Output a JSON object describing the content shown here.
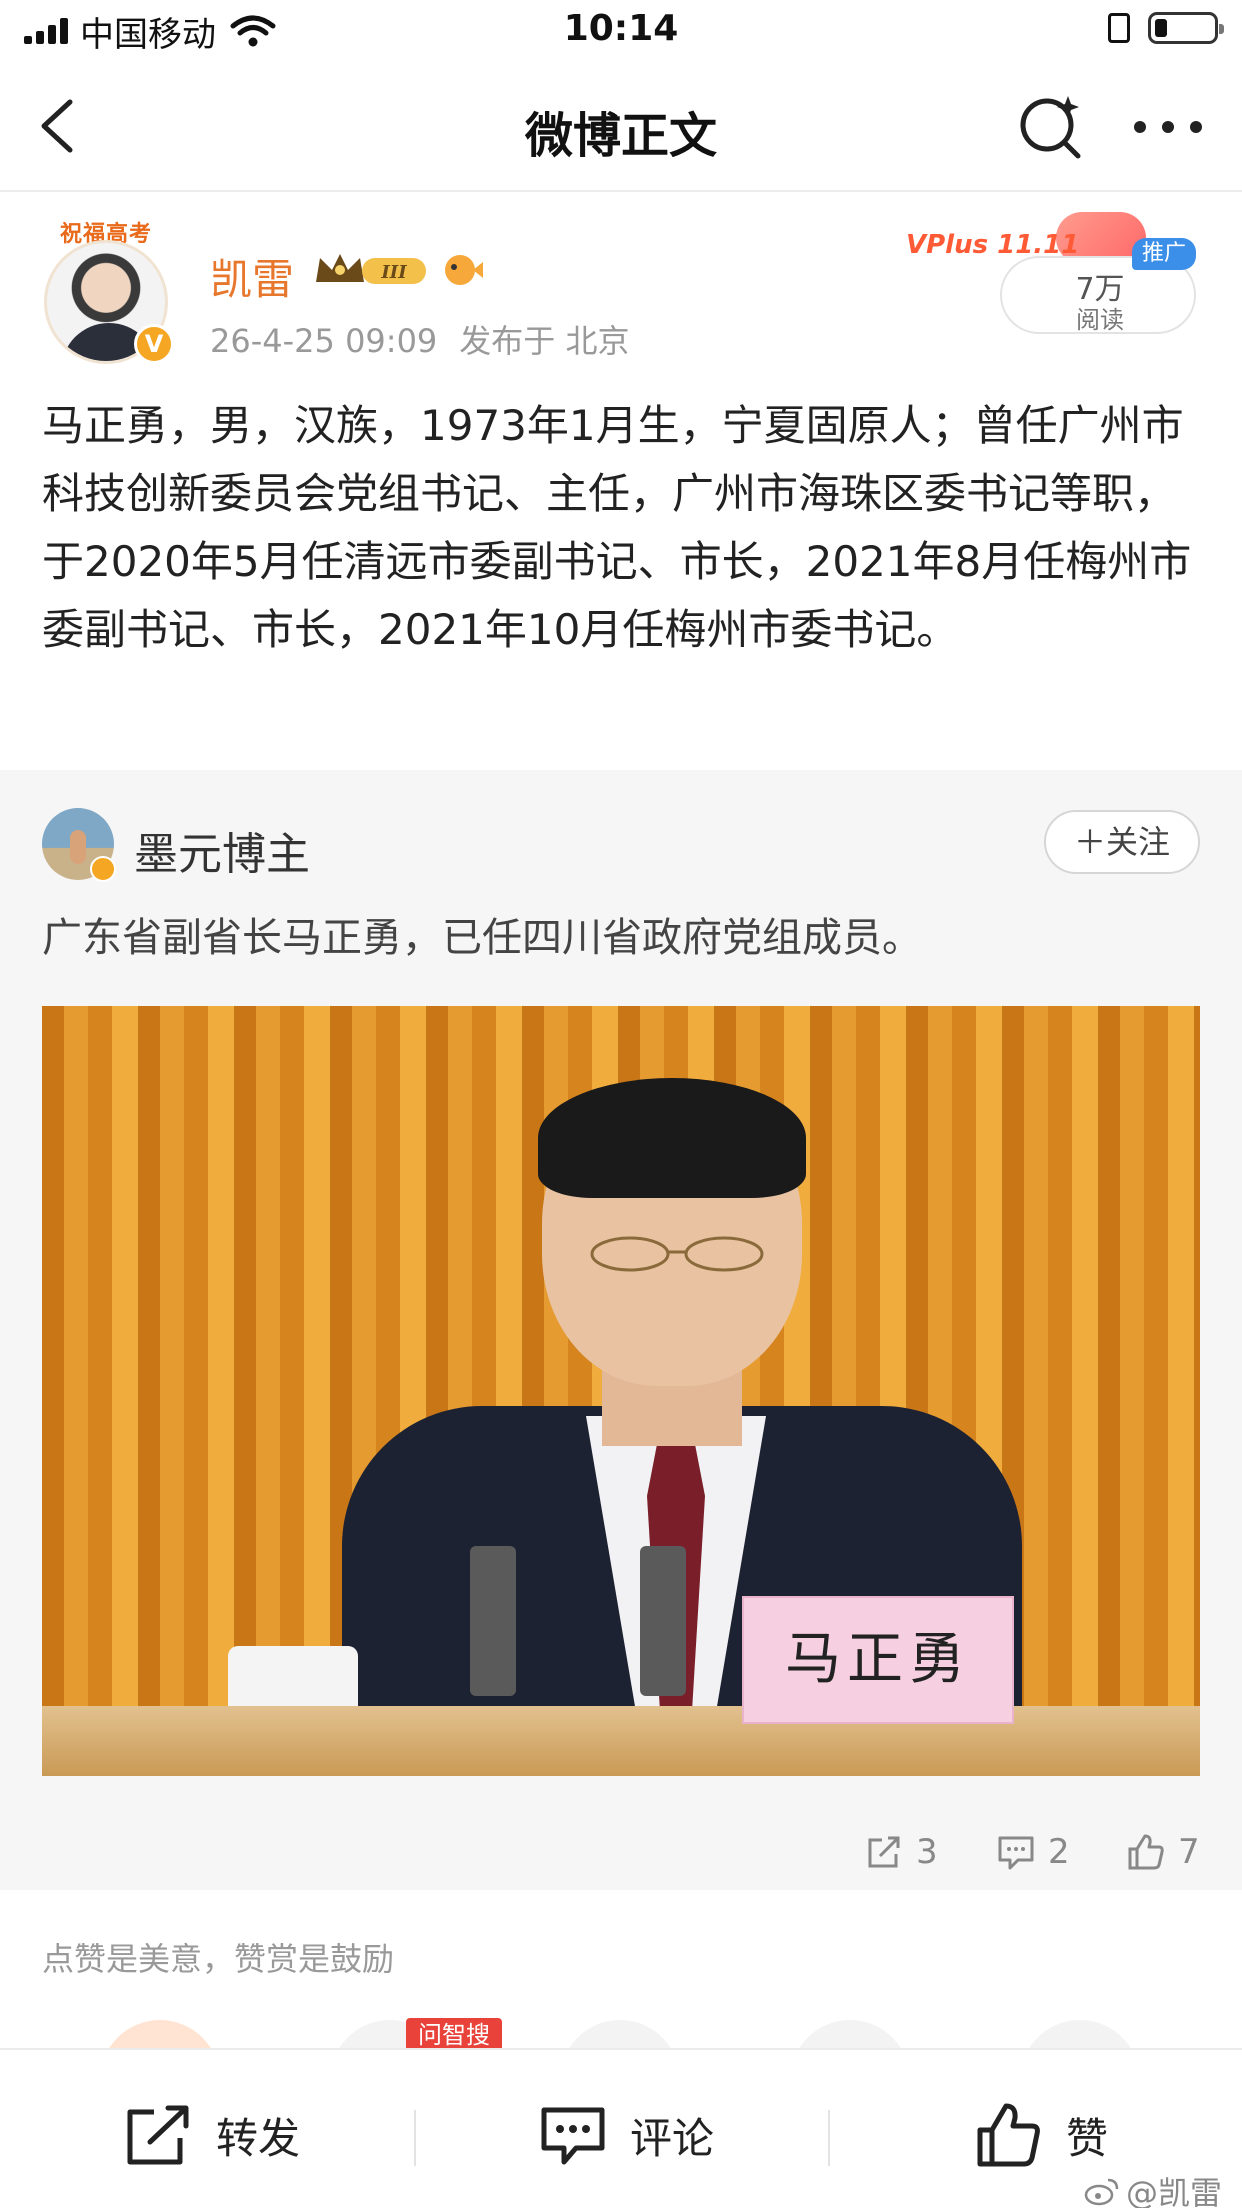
{
  "status_bar": {
    "carrier": "中国移动",
    "time": "10:14"
  },
  "nav": {
    "title": "微博正文",
    "icons": [
      "back-icon",
      "search-icon",
      "more-icon"
    ]
  },
  "post": {
    "avatar_frame_text": "祝福高考",
    "author": "凯雷",
    "level_badge": "III",
    "date": "26-4-25 09:09",
    "location": "发布于 北京",
    "promo": {
      "brand": "VPlus 11.11",
      "count": "7万",
      "label": "阅读",
      "tag": "推广"
    },
    "text": "马正勇，男，汉族，1973年1月生，宁夏固原人；曾任广州市科技创新委员会党组书记、主任，广州市海珠区委书记等职，于2020年5月任清远市委副书记、市长，2021年8月任梅州市委副书记、市长，2021年10月任梅州市委书记。"
  },
  "repost": {
    "author": "墨元博主",
    "follow_label": "＋关注",
    "text": "广东省副省长马正勇，已任四川省政府党组成员。",
    "photo": {
      "nameplate": "马正勇"
    },
    "stats": {
      "reposts": "3",
      "comments": "2",
      "likes": "7"
    }
  },
  "reward": {
    "text": "点赞是美意，赞赏是鼓励",
    "ask_tag": "问智搜"
  },
  "bottom_bar": {
    "repost_label": "转发",
    "comment_label": "评论",
    "like_label": "赞",
    "watermark": "@凯雷"
  },
  "colors": {
    "accent_orange": "#e8772e",
    "meta_gray": "#999999",
    "promo_blue": "#3b8fe8"
  }
}
